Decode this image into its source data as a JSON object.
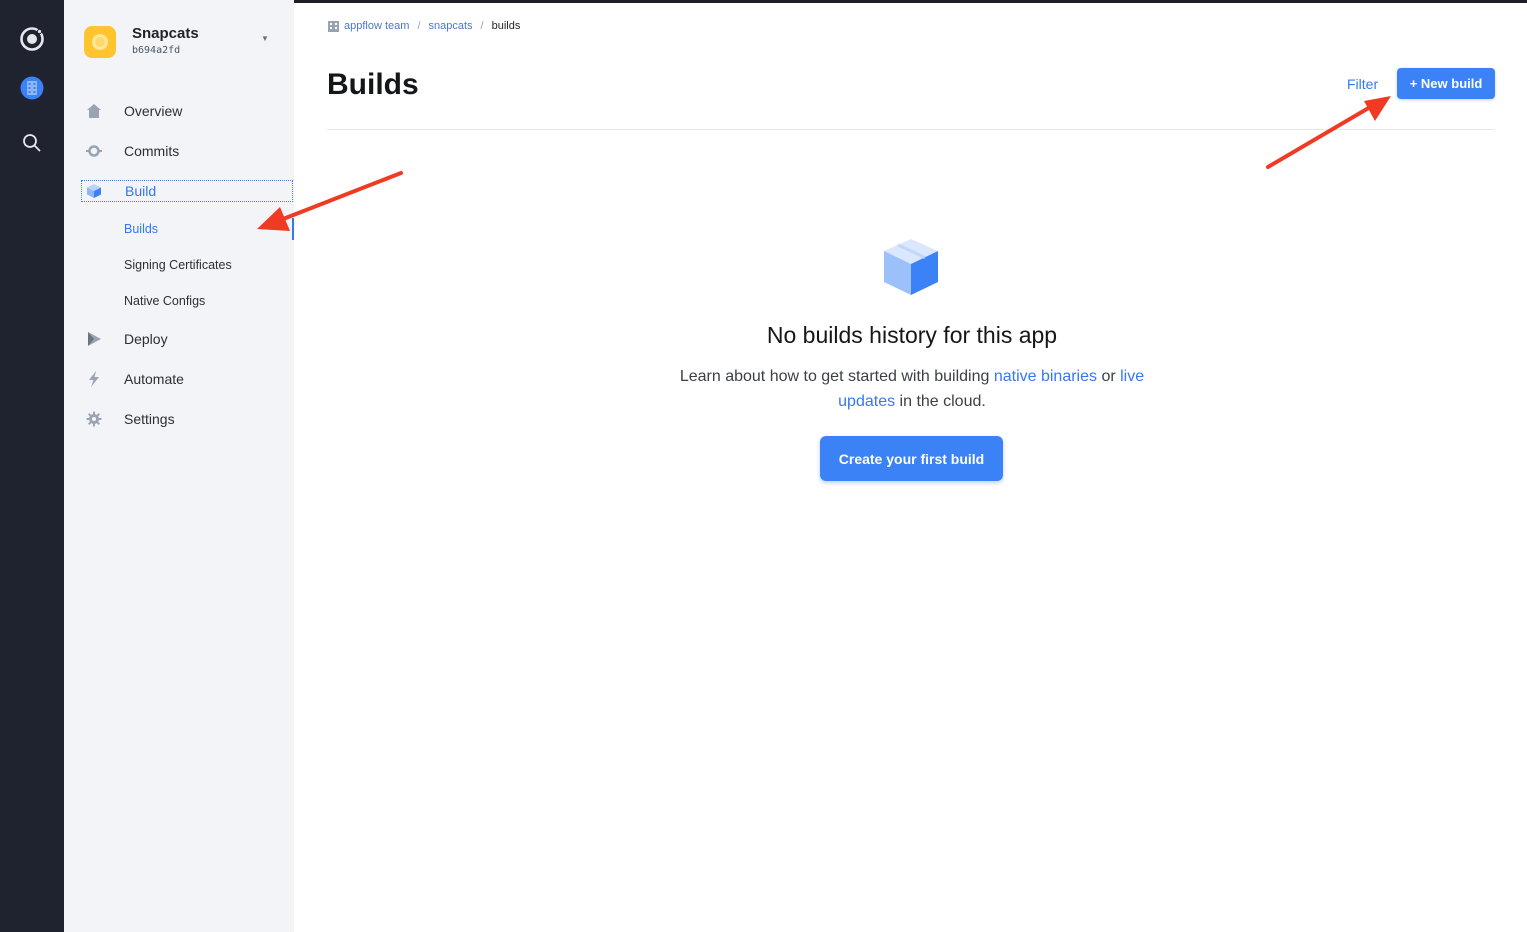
{
  "app": {
    "name": "Snapcats",
    "id": "b694a2fd"
  },
  "nav": {
    "overview": "Overview",
    "commits": "Commits",
    "build": "Build",
    "build_sub": {
      "builds": "Builds",
      "signing": "Signing Certificates",
      "native_configs": "Native Configs"
    },
    "deploy": "Deploy",
    "automate": "Automate",
    "settings": "Settings"
  },
  "breadcrumb": {
    "team": "appflow team",
    "sep1": "/",
    "app": "snapcats",
    "sep2": "/",
    "current": "builds"
  },
  "page": {
    "title": "Builds",
    "filter": "Filter",
    "new_build": "+ New build"
  },
  "empty": {
    "title": "No builds history for this app",
    "desc_prefix": "Learn about how to get started with building ",
    "link1": "native binaries",
    "desc_mid": " or ",
    "link2": "live updates",
    "desc_suffix": " in the cloud.",
    "cta": "Create your first build"
  },
  "colors": {
    "accent": "#3b82f6",
    "rail": "#1f2330",
    "sidebar": "#f2f4f8",
    "annotation_arrow": "#f03a24"
  }
}
